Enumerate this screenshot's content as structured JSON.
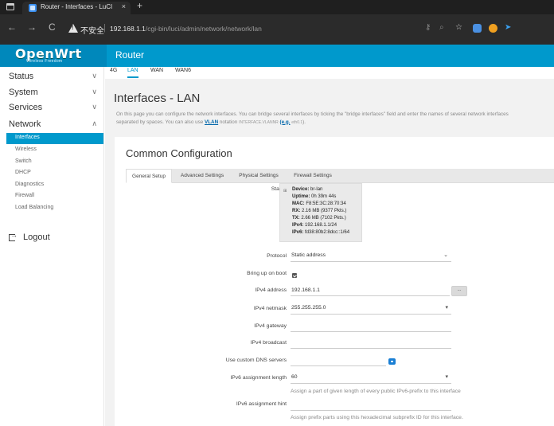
{
  "browser": {
    "tab_title": "Router - Interfaces - LuCI",
    "tab_close": "×",
    "new_tab": "+",
    "back": "←",
    "forward": "→",
    "reload": "C",
    "insecure_label": "不安全",
    "url_host": "192.168.1.1",
    "url_path": "/cgi-bin/luci/admin/network/network/lan",
    "address_icons": [
      "key-icon",
      "zoom-icon",
      "favorites-icon",
      "extension-icon",
      "extension-icon-2",
      "send-icon"
    ]
  },
  "header": {
    "logo": "OpenWrt",
    "logo_tagline": "Wireless Freedom",
    "brand": "Router",
    "color": "#0099cc"
  },
  "sidebar": {
    "categories": [
      {
        "label": "Status",
        "chevron": "∨"
      },
      {
        "label": "System",
        "chevron": "∨"
      },
      {
        "label": "Services",
        "chevron": "∨"
      },
      {
        "label": "Network",
        "chevron": "∧"
      }
    ],
    "network_items": [
      "Interfaces",
      "Wireless",
      "Switch",
      "DHCP",
      "Diagnostics",
      "Firewall",
      "Load Balancing"
    ],
    "active_item": "Interfaces",
    "logout": "Logout"
  },
  "interface_tabs": [
    "4G",
    "LAN",
    "WAN",
    "WAN6"
  ],
  "active_interface": "LAN",
  "page": {
    "title": "Interfaces - LAN",
    "desc_part1": "On this page you can configure the network interfaces. You can bridge several interfaces by ticking the \"bridge interfaces\" field and enter the names of several network interfaces",
    "desc_part2": "separated by spaces. You can also use",
    "desc_link": "VLAN",
    "desc_part3": "notation",
    "desc_small1": "INTERFACE.VLANNR",
    "desc_link2": "(e.g.",
    "desc_small2": "eth0.1",
    "desc_end": ")."
  },
  "config": {
    "title": "Common Configuration",
    "tabs": [
      "General Setup",
      "Advanced Settings",
      "Physical Settings",
      "Firewall Settings"
    ],
    "active_tab": "General Setup",
    "status_label": "Status",
    "status_icon": "network-port-icon",
    "status": [
      {
        "key": "Device:",
        "value": "br-lan"
      },
      {
        "key": "Uptime:",
        "value": "0h 39m 44s"
      },
      {
        "key": "MAC:",
        "value": "F8:5E:3C:28:70:34"
      },
      {
        "key": "RX:",
        "value": "2.16 MB (9377 Pkts.)"
      },
      {
        "key": "TX:",
        "value": "2.66 MB (7102 Pkts.)"
      },
      {
        "key": "IPv4:",
        "value": "192.168.1.1/24"
      },
      {
        "key": "IPv6:",
        "value": "fd38:80b2:8dcc::1/64"
      }
    ],
    "protocol_label": "Protocol",
    "protocol_value": "Static address",
    "boot_label": "Bring up on boot",
    "boot_checked": true,
    "ipv4_address_label": "IPv4 address",
    "ipv4_address_value": "192.168.1.1",
    "dots_label": "...",
    "ipv4_netmask_label": "IPv4 netmask",
    "ipv4_netmask_value": "255.255.255.0",
    "ipv4_gateway_label": "IPv4 gateway",
    "ipv4_gateway_value": "",
    "ipv4_broadcast_label": "IPv4 broadcast",
    "ipv4_broadcast_value": "",
    "dns_label": "Use custom DNS servers",
    "ipv6_len_label": "IPv6 assignment length",
    "ipv6_len_value": "60",
    "ipv6_len_hint": "Assign a part of given length of every public IPv6-prefix to this interface",
    "ipv6_hint_label": "IPv6 assignment hint",
    "ipv6_hint_value": "",
    "ipv6_hint_hint": "Assign prefix parts using this hexadecimal subprefix ID for this interface."
  }
}
